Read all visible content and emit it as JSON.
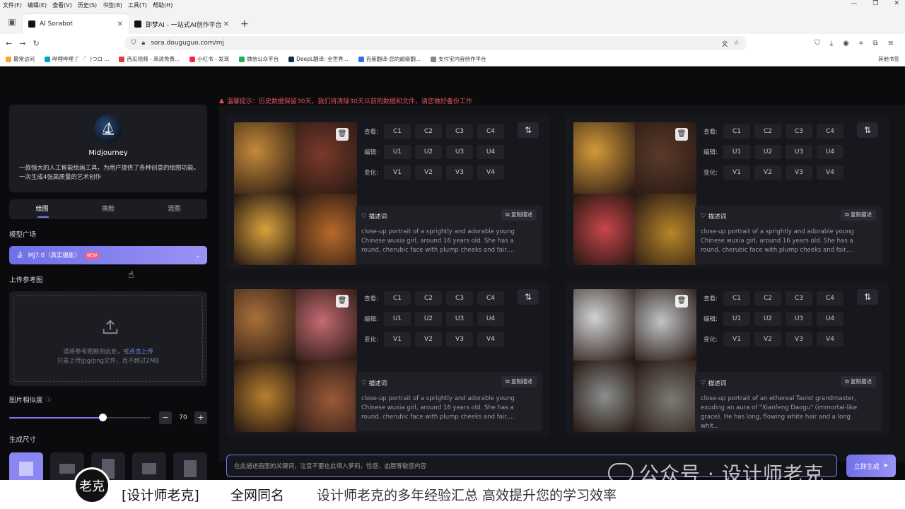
{
  "browser": {
    "menu": [
      "文件(F)",
      "编辑(E)",
      "查看(V)",
      "历史(S)",
      "书签(B)",
      "工具(T)",
      "帮助(H)"
    ],
    "tabs": [
      {
        "label": "AI Sorabot",
        "active": true
      },
      {
        "label": "即梦AI - 一站式AI创作平台",
        "active": false
      }
    ],
    "url": "sora.douguguo.com/mj",
    "bookmarks": [
      {
        "label": "最常访问",
        "color": "#f2a33a"
      },
      {
        "label": "哔哩哔哩 (゜-゜)つロ ...",
        "color": "#00a1d6"
      },
      {
        "label": "西瓜视频 - 高清免费...",
        "color": "#e23a3a"
      },
      {
        "label": "小红书 - 发现",
        "color": "#ff2442"
      },
      {
        "label": "微信公众平台",
        "color": "#22b14c"
      },
      {
        "label": "DeepL翻译: 全世界...",
        "color": "#0f2b46"
      },
      {
        "label": "百度翻译-您的超级翻...",
        "color": "#2f6fe0"
      },
      {
        "label": "支付宝内容创作平台",
        "color": "#888888"
      }
    ],
    "other_bookmarks": "其他书签"
  },
  "warning": "温馨提示：历史数据保留30天，我们将清除30天以前的数据和文件，请您做好备份工作",
  "sidebar": {
    "name": "Midjourney",
    "description": "一款强大的人工智能绘画工具，为用户提供了各种创意的绘图功能。一次生成4张高质量的艺术创作",
    "modes": [
      "绘图",
      "换脸",
      "混图"
    ],
    "model_section": "模型广场",
    "model_value": "MJ7.0（真实摄影）",
    "model_badge": "NEW",
    "upload_section": "上传参考图",
    "upload_hint": "请将参考图拖到此处，或",
    "upload_link": "点击上传",
    "upload_limit": "只能上传jpg/png文件，且不超过2MB",
    "similarity_label": "图片相似度",
    "similarity_value": "70",
    "similarity_fraction": 0.66,
    "size_section": "生成尺寸"
  },
  "card_labels": {
    "view": "查看:",
    "edit": "编辑:",
    "vary": "变化:",
    "view_buttons": [
      "C1",
      "C2",
      "C3",
      "C4"
    ],
    "edit_buttons": [
      "U1",
      "U2",
      "U3",
      "U4"
    ],
    "vary_buttons": [
      "V1",
      "V2",
      "V3",
      "V4"
    ],
    "prompt_label": "描述词",
    "copy_label": "复制描述"
  },
  "cards": [
    {
      "prompt": "close-up portrait of a sprightly and adorable young Chinese wuxia girl, around 16 years old. She has a round, cherubic face with plump cheeks and fair,...",
      "palette": [
        "#c48a3a",
        "#7a3a2a",
        "#d9a23c",
        "#b86a2a"
      ]
    },
    {
      "prompt": "close-up portrait of a sprightly and adorable young Chinese wuxia girl, around 16 years old. She has a round, cherubic face with plump cheeks and fair,...",
      "palette": [
        "#d39a3a",
        "#5a3a2a",
        "#c9454a",
        "#b8862a"
      ]
    },
    {
      "prompt": "close-up portrait of a sprightly and adorable young Chinese wuxia girl, around 16 years old. She has a round, cherubic face with plump cheeks and fair,...",
      "palette": [
        "#a8703a",
        "#c46a72",
        "#b8802e",
        "#9a5a3a"
      ]
    },
    {
      "prompt": "close-up portrait of an ethereal Taoist grandmaster, exuding an aura of \"Xianfeng Daogu\" (immortal-like grace). He has long, flowing white hair and a long whit...",
      "palette": [
        "#cfd2d4",
        "#bfc4c7",
        "#8a8f8e",
        "#7c7a74"
      ]
    }
  ],
  "input_placeholder": "在此描述画面的关键词，注意不要在此填入萝莉，性感，血腥等敏感内容",
  "generate_label": "立即生成",
  "watermark": "公众号 · 设计师老克",
  "footer": {
    "logo_text": "老克",
    "brand": "[设计师老克]",
    "tag": "全网同名",
    "slogan": "设计师老克的多年经验汇总  高效提升您的学习效率"
  }
}
